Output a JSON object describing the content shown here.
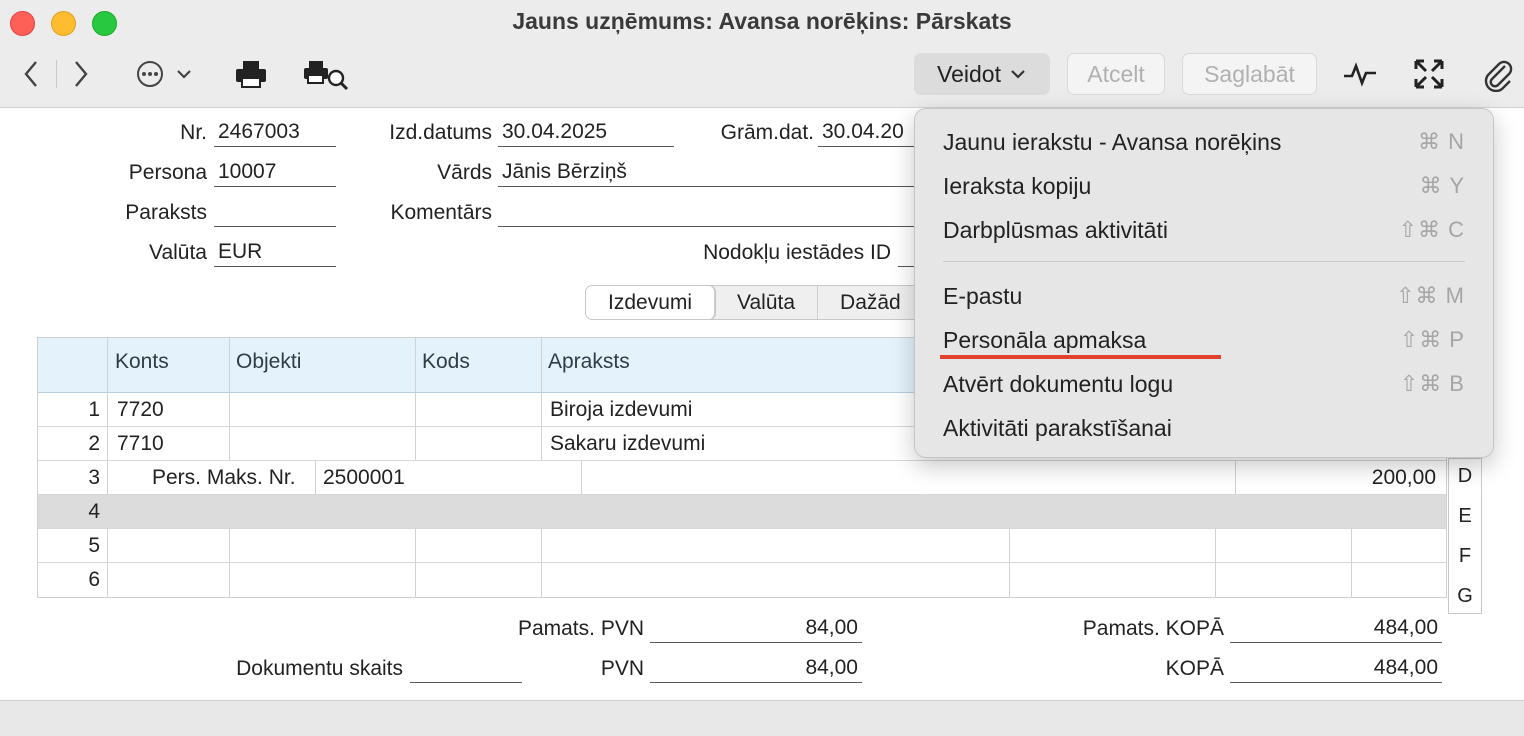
{
  "window": {
    "title": "Jauns uzņēmums: Avansa norēķins: Pārskats"
  },
  "toolbar": {
    "create_label": "Veidot",
    "cancel_label": "Atcelt",
    "save_label": "Saglabāt"
  },
  "form": {
    "nr_label": "Nr.",
    "nr_value": "2467003",
    "izd_label": "Izd.datums",
    "izd_value": "30.04.2025",
    "gram_label": "Grām.dat.",
    "gram_value": "30.04.20",
    "persona_label": "Persona",
    "persona_value": "10007",
    "vards_label": "Vārds",
    "vards_value": "Jānis Bērziņš",
    "paraksts_label": "Paraksts",
    "paraksts_value": "",
    "komentars_label": "Komentārs",
    "komentars_value": "",
    "valuta_label": "Valūta",
    "valuta_value": "EUR",
    "nodoklu_label": "Nodokļu iestādes ID",
    "nodoklu_value": ""
  },
  "tabs": [
    "Izdevumi",
    "Valūta",
    "Dažād"
  ],
  "grid": {
    "headers": [
      "Konts",
      "Objekti",
      "Kods",
      "Apraksts"
    ],
    "rows": [
      {
        "n": "1",
        "konts": "7720",
        "apraksts": "Biroja izdevumi"
      },
      {
        "n": "2",
        "konts": "7710",
        "apraksts": "Sakaru izdevumi"
      },
      {
        "n": "3",
        "pers_label": "Pers. Maks. Nr.",
        "pers_value": "2500001",
        "amount": "200,00"
      },
      {
        "n": "4"
      },
      {
        "n": "5"
      },
      {
        "n": "6"
      }
    ],
    "side_letters": [
      "D",
      "E",
      "F",
      "G"
    ]
  },
  "totals": {
    "pamats_pvn_label": "Pamats. PVN",
    "pamats_pvn_value": "84,00",
    "pvn_label": "PVN",
    "pvn_value": "84,00",
    "doc_count_label": "Dokumentu skaits",
    "doc_count_value": "",
    "pamats_kopa_label": "Pamats. KOPĀ",
    "pamats_kopa_value": "484,00",
    "kopa_label": "KOPĀ",
    "kopa_value": "484,00"
  },
  "menu": {
    "items": [
      {
        "label": "Jaunu ierakstu - Avansa norēķins",
        "shortcut": "⌘ N"
      },
      {
        "label": "Ieraksta kopiju",
        "shortcut": "⌘ Y"
      },
      {
        "label": "Darbplūsmas aktivitāti",
        "shortcut": "⇧⌘ C"
      },
      {
        "label": "E-pastu",
        "shortcut": "⇧⌘ M"
      },
      {
        "label": "Personāla apmaksa",
        "shortcut": "⇧⌘ P"
      },
      {
        "label": "Atvērt dokumentu logu",
        "shortcut": "⇧⌘ B"
      },
      {
        "label": "Aktivitāti parakstīšanai",
        "shortcut": ""
      }
    ]
  },
  "colors": {
    "highlight_underline": "#e2412e",
    "grid_header_bg": "#e3f2fb"
  }
}
